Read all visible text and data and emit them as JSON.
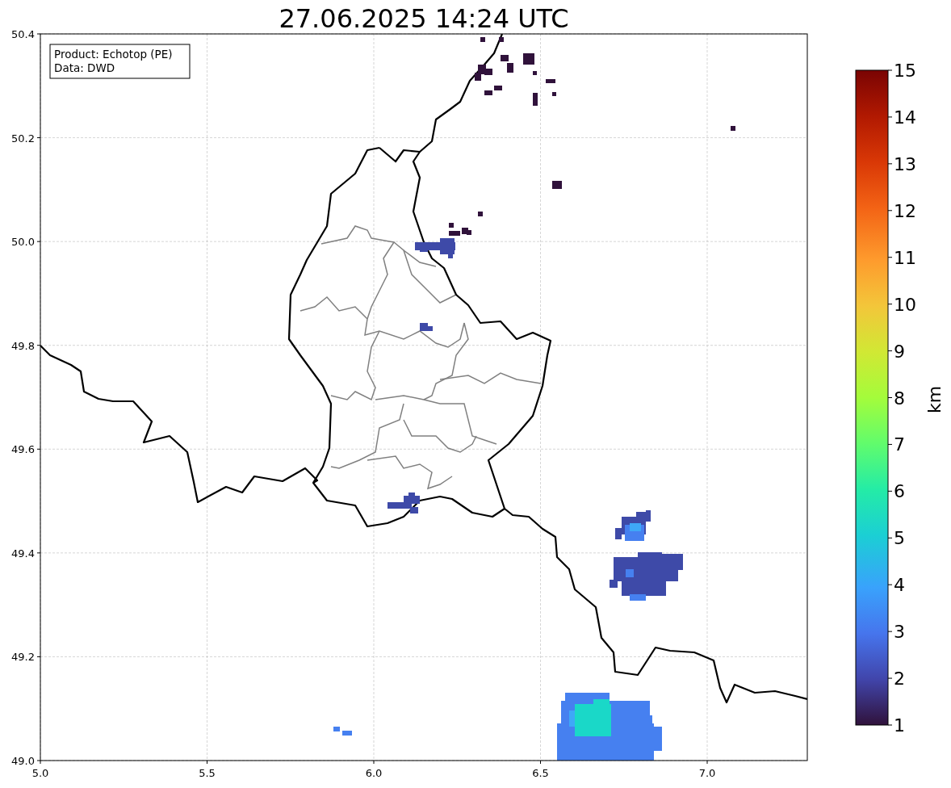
{
  "title": "27.06.2025 14:24 UTC",
  "legend": {
    "lines": [
      "Product: Echotop (PE)",
      "Data: DWD"
    ]
  },
  "x_ticks": [
    "5.0",
    "5.5",
    "6.0",
    "6.5",
    "7.0"
  ],
  "y_ticks": [
    "50.4",
    "50.2",
    "50.0",
    "49.8",
    "49.6",
    "49.4",
    "49.2",
    "49.0"
  ],
  "colorbar": {
    "label": "km",
    "ticks": [
      "15",
      "14",
      "13",
      "12",
      "11",
      "10",
      "9",
      "8",
      "7",
      "6",
      "5",
      "4",
      "3",
      "2",
      "1"
    ]
  }
}
